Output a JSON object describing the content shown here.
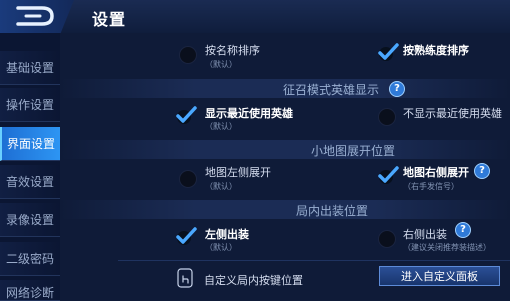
{
  "header": {
    "title": "设置"
  },
  "sidebar": {
    "tabs": [
      {
        "label": "基础设置"
      },
      {
        "label": "操作设置"
      },
      {
        "label": "界面设置"
      },
      {
        "label": "音效设置"
      },
      {
        "label": "录像设置"
      },
      {
        "label": "二级密码"
      },
      {
        "label": "网络诊断"
      }
    ],
    "active": "界面设置"
  },
  "sort": {
    "name": {
      "label": "按名称排序",
      "sub": "（默认）"
    },
    "proficiency": {
      "label": "按熟练度排序"
    }
  },
  "hero_display": {
    "title": "征召模式英雄显示",
    "show_recent": {
      "label": "显示最近使用英雄",
      "sub": "（默认）"
    },
    "hide_recent": {
      "label": "不显示最近使用英雄"
    }
  },
  "minimap": {
    "title": "小地图展开位置",
    "left": {
      "label": "地图左侧展开",
      "sub": "（默认）"
    },
    "right": {
      "label": "地图右侧展开",
      "sub": "（右手发信号）"
    }
  },
  "equipment": {
    "title": "局内出装位置",
    "left": {
      "label": "左侧出装",
      "sub": "（默认）"
    },
    "right": {
      "label": "右侧出装",
      "sub": "（建议关闭推荐装描述）"
    }
  },
  "custom": {
    "label": "自定义局内按键位置",
    "button": "进入自定义面板"
  },
  "colors": {
    "accent": "#2d95f3",
    "check": "#4aa8ff",
    "background": "#0f1b38"
  }
}
